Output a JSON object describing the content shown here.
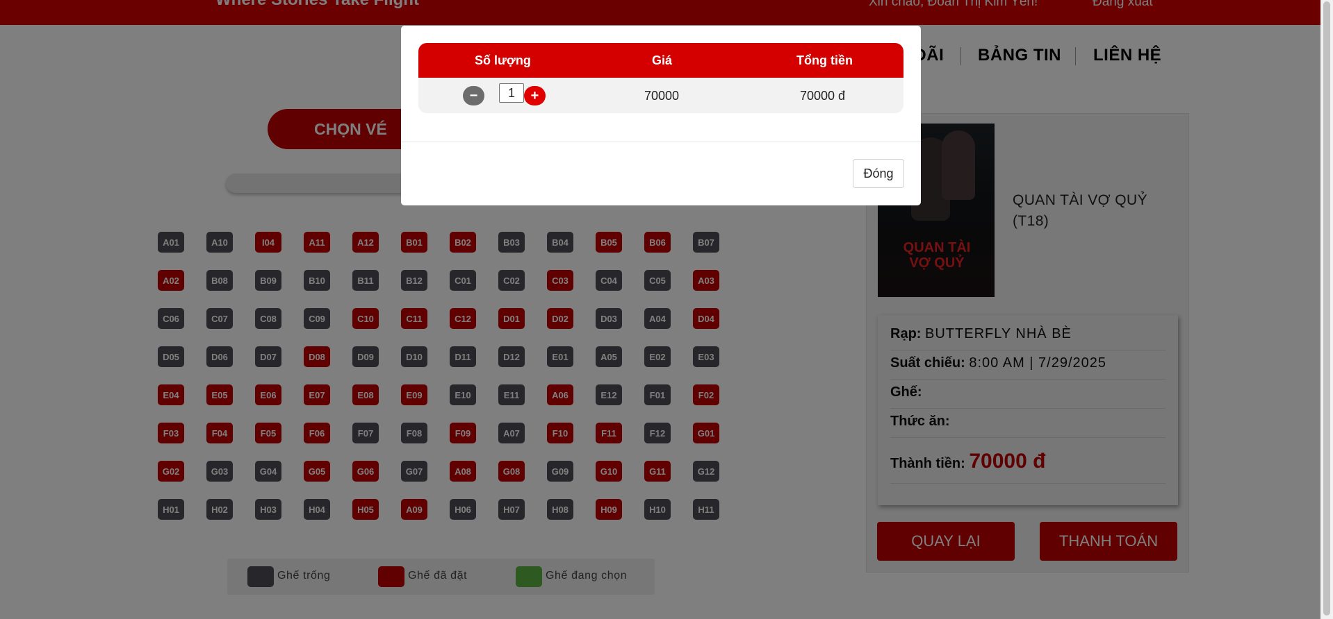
{
  "header": {
    "tagline": "Where Stories Take Flight",
    "greeting": "Xin chào, Đoàn Thị Kim Yến!",
    "logout": "Đăng xuất"
  },
  "nav": {
    "items": [
      "ƯU ĐÃI",
      "BẢNG TIN",
      "LIÊN HỆ"
    ]
  },
  "booking": {
    "choose_ticket": "CHỌN VÉ"
  },
  "seats": {
    "rows": [
      [
        [
          "A01",
          "free"
        ],
        [
          "A10",
          "free"
        ],
        [
          "I04",
          "booked"
        ],
        [
          "A11",
          "booked"
        ],
        [
          "A12",
          "booked"
        ],
        [
          "B01",
          "booked"
        ],
        [
          "B02",
          "booked"
        ],
        [
          "B03",
          "free"
        ],
        [
          "B04",
          "free"
        ],
        [
          "B05",
          "booked"
        ],
        [
          "B06",
          "booked"
        ],
        [
          "B07",
          "free"
        ]
      ],
      [
        [
          "A02",
          "booked"
        ],
        [
          "B08",
          "free"
        ],
        [
          "B09",
          "free"
        ],
        [
          "B10",
          "free"
        ],
        [
          "B11",
          "free"
        ],
        [
          "B12",
          "free"
        ],
        [
          "C01",
          "free"
        ],
        [
          "C02",
          "free"
        ],
        [
          "C03",
          "booked"
        ],
        [
          "C04",
          "free"
        ],
        [
          "C05",
          "free"
        ],
        [
          "A03",
          "booked"
        ]
      ],
      [
        [
          "C06",
          "free"
        ],
        [
          "C07",
          "free"
        ],
        [
          "C08",
          "free"
        ],
        [
          "C09",
          "free"
        ],
        [
          "C10",
          "booked"
        ],
        [
          "C11",
          "booked"
        ],
        [
          "C12",
          "booked"
        ],
        [
          "D01",
          "booked"
        ],
        [
          "D02",
          "booked"
        ],
        [
          "D03",
          "free"
        ],
        [
          "A04",
          "free"
        ],
        [
          "D04",
          "booked"
        ]
      ],
      [
        [
          "D05",
          "free"
        ],
        [
          "D06",
          "free"
        ],
        [
          "D07",
          "free"
        ],
        [
          "D08",
          "booked"
        ],
        [
          "D09",
          "free"
        ],
        [
          "D10",
          "free"
        ],
        [
          "D11",
          "free"
        ],
        [
          "D12",
          "free"
        ],
        [
          "E01",
          "free"
        ],
        [
          "A05",
          "free"
        ],
        [
          "E02",
          "free"
        ],
        [
          "E03",
          "free"
        ]
      ],
      [
        [
          "E04",
          "booked"
        ],
        [
          "E05",
          "booked"
        ],
        [
          "E06",
          "booked"
        ],
        [
          "E07",
          "booked"
        ],
        [
          "E08",
          "booked"
        ],
        [
          "E09",
          "booked"
        ],
        [
          "E10",
          "free"
        ],
        [
          "E11",
          "free"
        ],
        [
          "A06",
          "booked"
        ],
        [
          "E12",
          "free"
        ],
        [
          "F01",
          "free"
        ],
        [
          "F02",
          "booked"
        ]
      ],
      [
        [
          "F03",
          "booked"
        ],
        [
          "F04",
          "booked"
        ],
        [
          "F05",
          "booked"
        ],
        [
          "F06",
          "booked"
        ],
        [
          "F07",
          "free"
        ],
        [
          "F08",
          "free"
        ],
        [
          "F09",
          "booked"
        ],
        [
          "A07",
          "free"
        ],
        [
          "F10",
          "booked"
        ],
        [
          "F11",
          "booked"
        ],
        [
          "F12",
          "free"
        ],
        [
          "G01",
          "booked"
        ]
      ],
      [
        [
          "G02",
          "booked"
        ],
        [
          "G03",
          "free"
        ],
        [
          "G04",
          "free"
        ],
        [
          "G05",
          "booked"
        ],
        [
          "G06",
          "booked"
        ],
        [
          "G07",
          "free"
        ],
        [
          "A08",
          "booked"
        ],
        [
          "G08",
          "booked"
        ],
        [
          "G09",
          "free"
        ],
        [
          "G10",
          "booked"
        ],
        [
          "G11",
          "booked"
        ],
        [
          "G12",
          "free"
        ]
      ],
      [
        [
          "H01",
          "free"
        ],
        [
          "H02",
          "free"
        ],
        [
          "H03",
          "free"
        ],
        [
          "H04",
          "free"
        ],
        [
          "H05",
          "booked"
        ],
        [
          "A09",
          "booked"
        ],
        [
          "H06",
          "free"
        ],
        [
          "H07",
          "free"
        ],
        [
          "H08",
          "free"
        ],
        [
          "H09",
          "booked"
        ],
        [
          "H10",
          "free"
        ],
        [
          "H11",
          "free"
        ]
      ]
    ],
    "colors": {
      "free": "#4f4f56",
      "booked": "#c00000",
      "selected": "#5cb543"
    }
  },
  "legend": {
    "free": "Ghế trống",
    "booked": "Ghế đã đặt",
    "selected": "Ghế đang chọn"
  },
  "movie": {
    "title": "QUAN TÀI VỢ QUỶ (T18)",
    "poster_text": "QUAN TÀI VỢ QUỶ",
    "cinema_label": "Rạp:",
    "cinema": "BUTTERFLY NHÀ BÈ",
    "showtime_label": "Suất chiếu:",
    "showtime": "8:00 AM | 7/29/2025",
    "seat_label": "Ghế:",
    "seat": "",
    "food_label": "Thức ăn:",
    "food": "",
    "total_label": "Thành tiền:",
    "total": "70000 đ"
  },
  "actions": {
    "back": "QUAY LẠI",
    "pay": "THANH TOÁN"
  },
  "modal": {
    "headers": {
      "qty": "Số lượng",
      "price": "Giá",
      "total": "Tổng tiền"
    },
    "qty_value": "1",
    "minus": "−",
    "plus": "+",
    "price": "70000",
    "total": "70000 đ",
    "close": "Đóng"
  }
}
